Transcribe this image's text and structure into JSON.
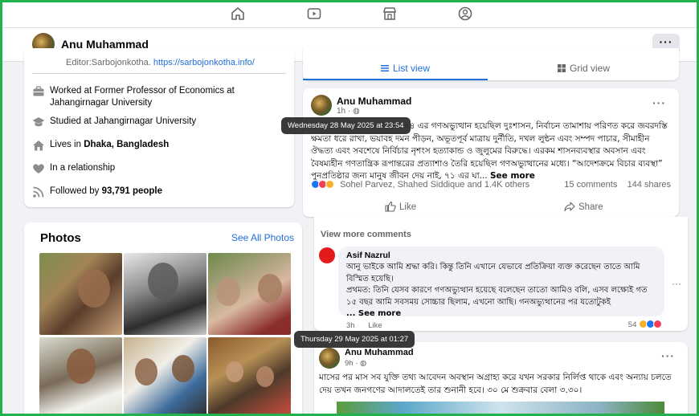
{
  "nav": {
    "icons": [
      "home-icon",
      "video-icon",
      "marketplace-icon",
      "groups-icon"
    ]
  },
  "profile": {
    "name": "Anu Muhammad",
    "more_label": "···"
  },
  "intro": {
    "editor_prefix": "Editor:Sarbojonkotha.",
    "editor_link": "https://sarbojonkotha.info/",
    "work": "Worked at Former Professor of Economics at Jahangirnagar University",
    "study": "Studied at Jahangirnagar University",
    "lives_prefix": "Lives in",
    "lives_place": "Dhaka, Bangladesh",
    "relationship": "In a relationship",
    "followed_prefix": "Followed by",
    "followed_count": "93,791 people"
  },
  "photos": {
    "title": "Photos",
    "see_all": "See All Photos"
  },
  "tabs": {
    "list_view": "List view",
    "grid_view": "Grid view"
  },
  "post1": {
    "author": "Anu Muhammad",
    "time": "1h",
    "tooltip": "Wednesday 28 May 2025 at 23:54",
    "body_visible_start": "নে। ২৪ এর গণঅভ্যুত্থান হয়েছিল দুঃশাসন, নির্বাচন তামাশায় পরিণত করে",
    "body_rest": "জবরদস্তি ক্ষমতা ধরে রাখা, ভয়াবহ দমন পীড়ন, অভূতপূর্ব মাত্রায় দুর্নীতি, দখল লুন্ঠন এবং সম্পদ পাচার, সীমাহীন ঔদ্ধত্য এবং সবশেষে নির্বিচার নৃশংস হত্যাকান্ড ও জুলুমের বিরুদ্ধে। এরকম শাসনব্যবস্থার অবসান এবং বৈষম্যহীন গণতান্ত্রিক রূপান্তরের প্রত্যাশাও তৈরি হয়েছিল গণঅভ্যুত্থানের মধ্যে। “আদেশক্রমে বিচার ব্যবস্থা” পুনপ্রতিষ্ঠার জন্য মানুষ জীবন দেয় নাই, ৭১ এর ঘা...",
    "see_more": "See more",
    "reactors": "Sohel Parvez, Shahed Siddique and 1.4K others",
    "comments_count": "15 comments",
    "shares_count": "144 shares",
    "like_label": "Like",
    "share_label": "Share"
  },
  "comments": {
    "view_more": "View more comments",
    "items": [
      {
        "name": "Asif Nazrul",
        "text_line1": "আনু ভাইকে আমি শ্রদ্ধা করি। কিন্তু তিনি এখানে যেভাবে প্রতিক্রিয়া ব্যক্ত করেছেন তাতে আমি বিস্মিত হয়েছি।",
        "text_line2": "প্রথমত: তিনি যেসব কারণে গণঅভ্যুত্থান হয়েছে বলেছেন তাতো আমিও বলি, এসব লক্ষ্যেই গত ১৫ বছর আমি সবসময় সোচ্চার ছিলাম, এখনো আছি। গনঅভ্যুত্থানের পর যতোটুকই",
        "see_more": "... See more",
        "time": "3h",
        "like_label": "Like",
        "reaction_count": "54"
      }
    ]
  },
  "post2": {
    "author": "Anu Muhammad",
    "time": "9h",
    "tooltip": "Thursday 29 May 2025 at 01:27",
    "body": "মাসের পর মাস সব যুক্তি তথ্য আবেদন অবস্থান অগ্রাহ্য করে যখন সরকার নির্লিপ্ত থাকে এবং অন্যায় চলতে দেয় তখন জনগণের আদালতেই তার শুনানী হবে। ৩০ মে শুক্রবার বেলা ৩.৩০।"
  },
  "colors": {
    "accent": "#216fdb",
    "frame": "#22b14c",
    "background": "#f0f2f5"
  }
}
